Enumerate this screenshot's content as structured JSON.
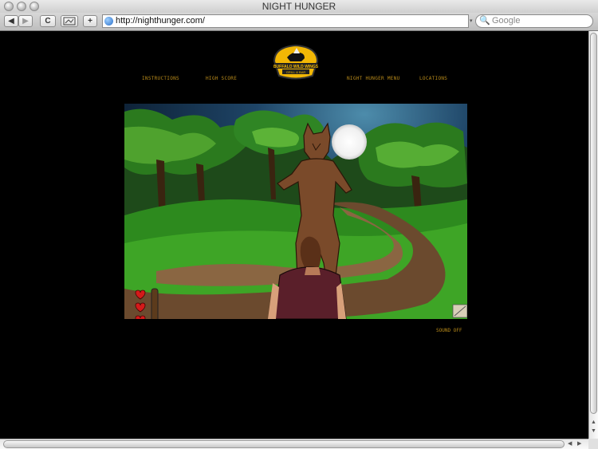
{
  "browser": {
    "title": "NIGHT HUNGER",
    "url": "http://nighthunger.com/",
    "search_placeholder": "Google",
    "back_label": "◀",
    "forward_label": "▶",
    "reload_label": "C",
    "add_label": "+"
  },
  "site": {
    "nav": {
      "instructions": "INSTRUCTIONS",
      "high_score": "HIGH SCORE",
      "menu": "NIGHT HUNGER MENU",
      "locations": "LOCATIONS"
    },
    "logo": {
      "brand": "BUFFALO WILD WINGS",
      "subline": "GRILL & BAR"
    },
    "sound_label": "SOUND OFF",
    "accent_color": "#b88a1a",
    "game": {
      "lives": 3,
      "hunger_level": 0.15
    }
  }
}
